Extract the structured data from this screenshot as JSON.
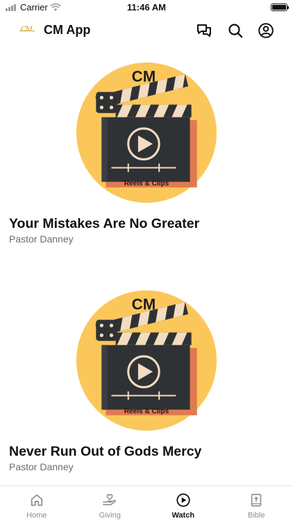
{
  "status_bar": {
    "carrier": "Carrier",
    "time": "11:46 AM",
    "battery_level": 1.0
  },
  "header": {
    "logo_text": "CM",
    "title": "CM App",
    "icons": [
      "chat-bubbles-icon",
      "search-icon",
      "profile-icon"
    ]
  },
  "thumbnail": {
    "brand": "CM",
    "caption": "Reels & Clips",
    "colors": {
      "circle": "#fbc75a",
      "clapper_body": "#2f3235",
      "accent": "#e07b50",
      "stripe": "#f3dcc0"
    }
  },
  "videos": [
    {
      "title": "Your Mistakes Are No Greater",
      "speaker": "Pastor Danney"
    },
    {
      "title": "Never Run Out of Gods Mercy",
      "speaker": "Pastor Danney"
    }
  ],
  "tabs": [
    {
      "label": "Home",
      "icon": "home-icon",
      "active": false
    },
    {
      "label": "Giving",
      "icon": "giving-hand-heart-icon",
      "active": false
    },
    {
      "label": "Watch",
      "icon": "play-circle-icon",
      "active": true
    },
    {
      "label": "Bible",
      "icon": "bible-book-icon",
      "active": false
    }
  ],
  "colors": {
    "text_primary": "#111111",
    "text_secondary": "#6b6b6b",
    "tab_inactive": "#8e8e8e",
    "logo_gold": "#c9a227"
  }
}
